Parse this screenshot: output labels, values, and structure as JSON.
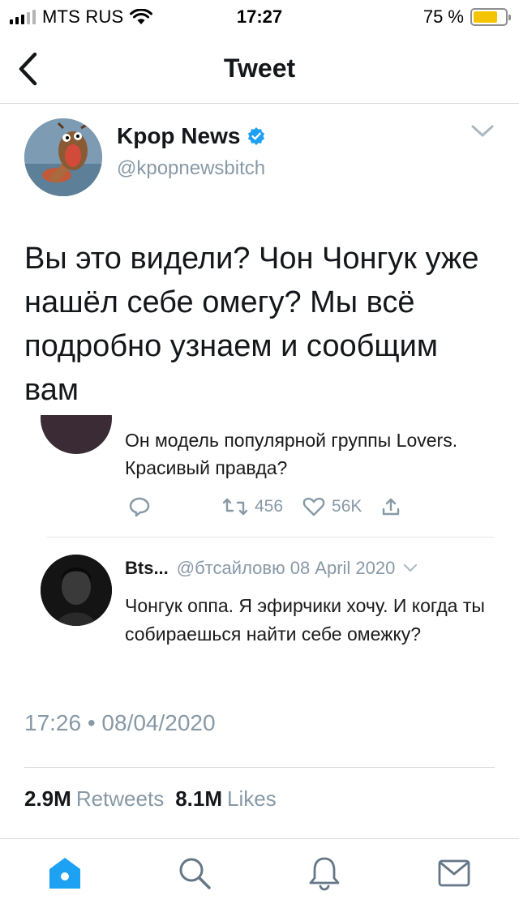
{
  "status_bar": {
    "carrier": "MTS RUS",
    "time": "17:27",
    "battery_percent": "75 %",
    "battery_level": 0.75,
    "wifi_icon": "wifi-icon"
  },
  "nav": {
    "title": "Tweet",
    "back_icon": "back-chevron-icon"
  },
  "author": {
    "name": "Kpop News",
    "handle": "@kpopnewsbitch",
    "verified": true
  },
  "tweet": {
    "text": "Вы это видели? Чон Чонгук уже нашёл себе омегу? Мы всё подробно узнаем и сообщим вам",
    "timestamp": "17:26 • 08/04/2020"
  },
  "embedded": {
    "first_text": "Он модель популярной группы Lovers. Красивый правда?",
    "retweets": "456",
    "likes": "56K",
    "reply_name": "Bts...",
    "reply_handle_date": "@бтсайловю 08 April 2020",
    "reply_text": "Чонгук оппа. Я эфирчики хочу. И когда ты собираешься найти себе омежку?"
  },
  "stats": {
    "retweets_count": "2.9M",
    "retweets_label": "Retweets",
    "likes_count": "8.1M",
    "likes_label": "Likes"
  },
  "tabs": [
    {
      "icon": "home-icon",
      "active": true
    },
    {
      "icon": "search-icon",
      "active": false
    },
    {
      "icon": "bell-icon",
      "active": false
    },
    {
      "icon": "mail-icon",
      "active": false
    }
  ],
  "colors": {
    "accent": "#1da1f2",
    "muted": "#8899a6",
    "battery": "#f5c400"
  }
}
